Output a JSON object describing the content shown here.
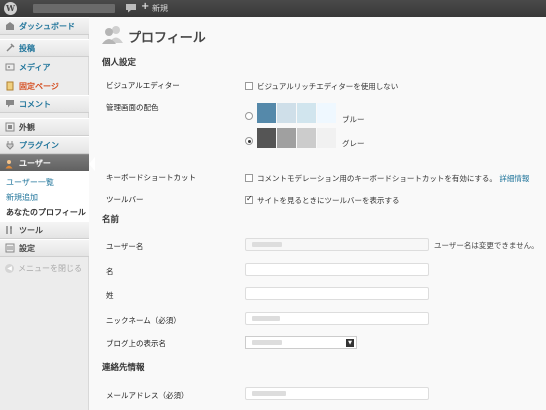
{
  "admin_bar": {
    "wp_logo": "W",
    "new_label": "新規",
    "plus": "+"
  },
  "sidebar": {
    "items": [
      {
        "label": "ダッシュボード",
        "icon": "dashboard-icon"
      },
      {
        "label": "投稿",
        "icon": "pin-icon"
      },
      {
        "label": "メディア",
        "icon": "media-icon"
      },
      {
        "label": "固定ページ",
        "icon": "page-icon"
      },
      {
        "label": "コメント",
        "icon": "comment-icon"
      },
      {
        "label": "外観",
        "icon": "appearance-icon"
      },
      {
        "label": "プラグイン",
        "icon": "plugin-icon"
      },
      {
        "label": "ユーザー",
        "icon": "users-icon"
      },
      {
        "label": "ツール",
        "icon": "tools-icon"
      },
      {
        "label": "設定",
        "icon": "settings-icon"
      },
      {
        "label": "メニューを閉じる",
        "icon": "collapse-icon"
      }
    ],
    "submenu": [
      {
        "label": "ユーザー一覧"
      },
      {
        "label": "新規追加"
      },
      {
        "label": "あなたのプロフィール"
      }
    ]
  },
  "page": {
    "title": "プロフィール",
    "sections": {
      "personal": "個人設定",
      "name": "名前",
      "contact": "連絡先情報"
    },
    "visual_editor": {
      "label": "ビジュアルエディター",
      "option": "ビジュアルリッチエディターを使用しない",
      "checked": false
    },
    "color_scheme": {
      "label": "管理画面の配色",
      "options": [
        {
          "name": "ブルー",
          "colors": [
            "#5589aa",
            "#cfdfe9",
            "#d1e5ee",
            "#eff8ff"
          ],
          "selected": false
        },
        {
          "name": "グレー",
          "colors": [
            "#555555",
            "#a0a0a0",
            "#cccccc",
            "#f1f1f1"
          ],
          "selected": true
        }
      ]
    },
    "keyboard": {
      "label": "キーボードショートカット",
      "option": "コメントモデレーション用のキーボードショートカットを有効にする。",
      "link": "詳細情報",
      "checked": false
    },
    "toolbar": {
      "label": "ツールバー",
      "option": "サイトを見るときにツールバーを表示する",
      "checked": true
    },
    "fields": {
      "username_label": "ユーザー名",
      "username_note": "ユーザー名は変更できません。",
      "first_name_label": "名",
      "last_name_label": "姓",
      "nickname_label": "ニックネーム（必須）",
      "display_name_label": "ブログ上の表示名",
      "email_label": "メールアドレス（必須）"
    }
  }
}
